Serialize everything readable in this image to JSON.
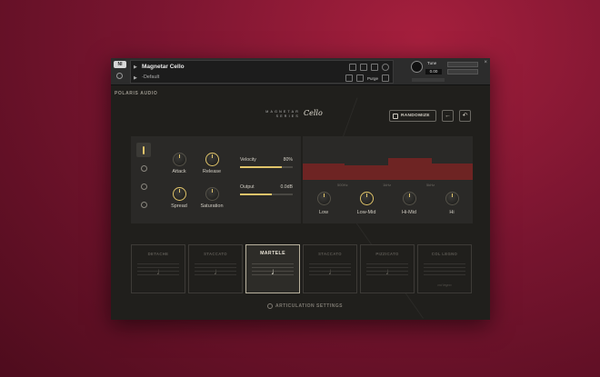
{
  "host": {
    "instrument_name": "Magnetar Cello",
    "preset": "-Default",
    "tune_label": "Tune",
    "tune_value": "0.00",
    "purge_label": "Purge"
  },
  "header": {
    "brand": "POLARIS AUDIO",
    "series_line1": "MAGNETAR",
    "series_line2": "SERIES",
    "product": "Cello",
    "randomize_label": "RANDOMIZE",
    "back_icon": "arrow-left-icon",
    "reset_icon": "undo-icon"
  },
  "controls": {
    "attack_label": "Attack",
    "release_label": "Release",
    "spread_label": "Spread",
    "saturation_label": "Saturation",
    "velocity_label": "Velocity",
    "velocity_value": "80%",
    "velocity_level": 0.8,
    "output_label": "Output",
    "output_value": "0.0dB",
    "output_level": 0.6,
    "accent_color": "#e0c46a"
  },
  "eq": {
    "freq_labels": [
      "500Hz",
      "1kHz",
      "5kHz"
    ],
    "bands": [
      {
        "label": "Low"
      },
      {
        "label": "Low-Mid"
      },
      {
        "label": "Hi-Mid"
      },
      {
        "label": "Hi"
      }
    ],
    "bar_color": "#6e2423"
  },
  "articulations": {
    "items": [
      {
        "title": "DETACHE",
        "sub": "",
        "active": false
      },
      {
        "title": "STACCATO",
        "sub": "",
        "active": false
      },
      {
        "title": "MARTELE",
        "sub": "",
        "active": true
      },
      {
        "title": "STACCATO",
        "sub": "",
        "active": false
      },
      {
        "title": "PIZZICATO",
        "sub": "",
        "active": false
      },
      {
        "title": "COL LEGNO",
        "sub": "col legno",
        "active": false
      }
    ],
    "settings_label": "ARTICULATION SETTINGS"
  }
}
